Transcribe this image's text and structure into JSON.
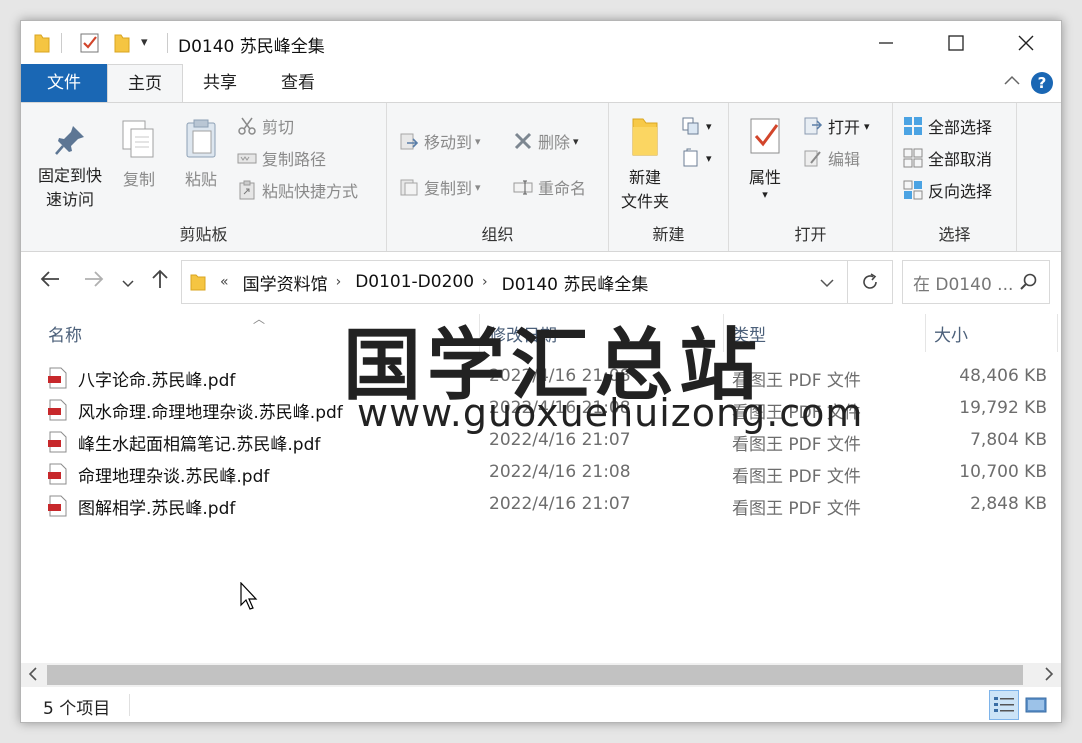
{
  "title": "D0140 苏民峰全集",
  "tabs": {
    "file": "文件",
    "home": "主页",
    "share": "共享",
    "view": "查看"
  },
  "help_label": "?",
  "ribbon": {
    "clipboard": {
      "label": "剪贴板",
      "pin_line1": "固定到快",
      "pin_line2": "速访问",
      "copy": "复制",
      "paste": "粘贴",
      "cut": "剪切",
      "copy_path": "复制路径",
      "paste_shortcut": "粘贴快捷方式"
    },
    "organize": {
      "label": "组织",
      "move_to": "移动到",
      "copy_to": "复制到",
      "delete": "删除",
      "rename": "重命名"
    },
    "new": {
      "label": "新建",
      "new_folder_line1": "新建",
      "new_folder_line2": "文件夹"
    },
    "open": {
      "label": "打开",
      "properties": "属性",
      "open": "打开",
      "edit": "编辑"
    },
    "select": {
      "label": "选择",
      "select_all": "全部选择",
      "select_none": "全部取消",
      "invert": "反向选择"
    }
  },
  "address": {
    "overflow": "«",
    "segments": [
      "国学资料馆",
      "D0101-D0200",
      "D0140 苏民峰全集"
    ]
  },
  "search": {
    "placeholder": "在 D0140 ..."
  },
  "columns": {
    "name": "名称",
    "date": "修改日期",
    "type": "类型",
    "size": "大小"
  },
  "files": [
    {
      "name": "八字论命.苏民峰.pdf",
      "date": "2022/4/16 21:08",
      "type": "看图王 PDF 文件",
      "size": "48,406 KB"
    },
    {
      "name": "风水命理.命理地理杂谈.苏民峰.pdf",
      "date": "2022/4/16 21:08",
      "type": "看图王 PDF 文件",
      "size": "19,792 KB"
    },
    {
      "name": "峰生水起面相篇笔记.苏民峰.pdf",
      "date": "2022/4/16 21:07",
      "type": "看图王 PDF 文件",
      "size": "7,804 KB"
    },
    {
      "name": "命理地理杂谈.苏民峰.pdf",
      "date": "2022/4/16 21:08",
      "type": "看图王 PDF 文件",
      "size": "10,700 KB"
    },
    {
      "name": "图解相学.苏民峰.pdf",
      "date": "2022/4/16 21:07",
      "type": "看图王 PDF 文件",
      "size": "2,848 KB"
    }
  ],
  "watermark": {
    "cn": "国学汇总站",
    "url": "www.guoxuehuizong.com"
  },
  "status": {
    "count": "5 个项目"
  },
  "colors": {
    "accent": "#1a67b4",
    "ribbon_bg": "#f5f6f7",
    "header_text": "#4c607a"
  }
}
